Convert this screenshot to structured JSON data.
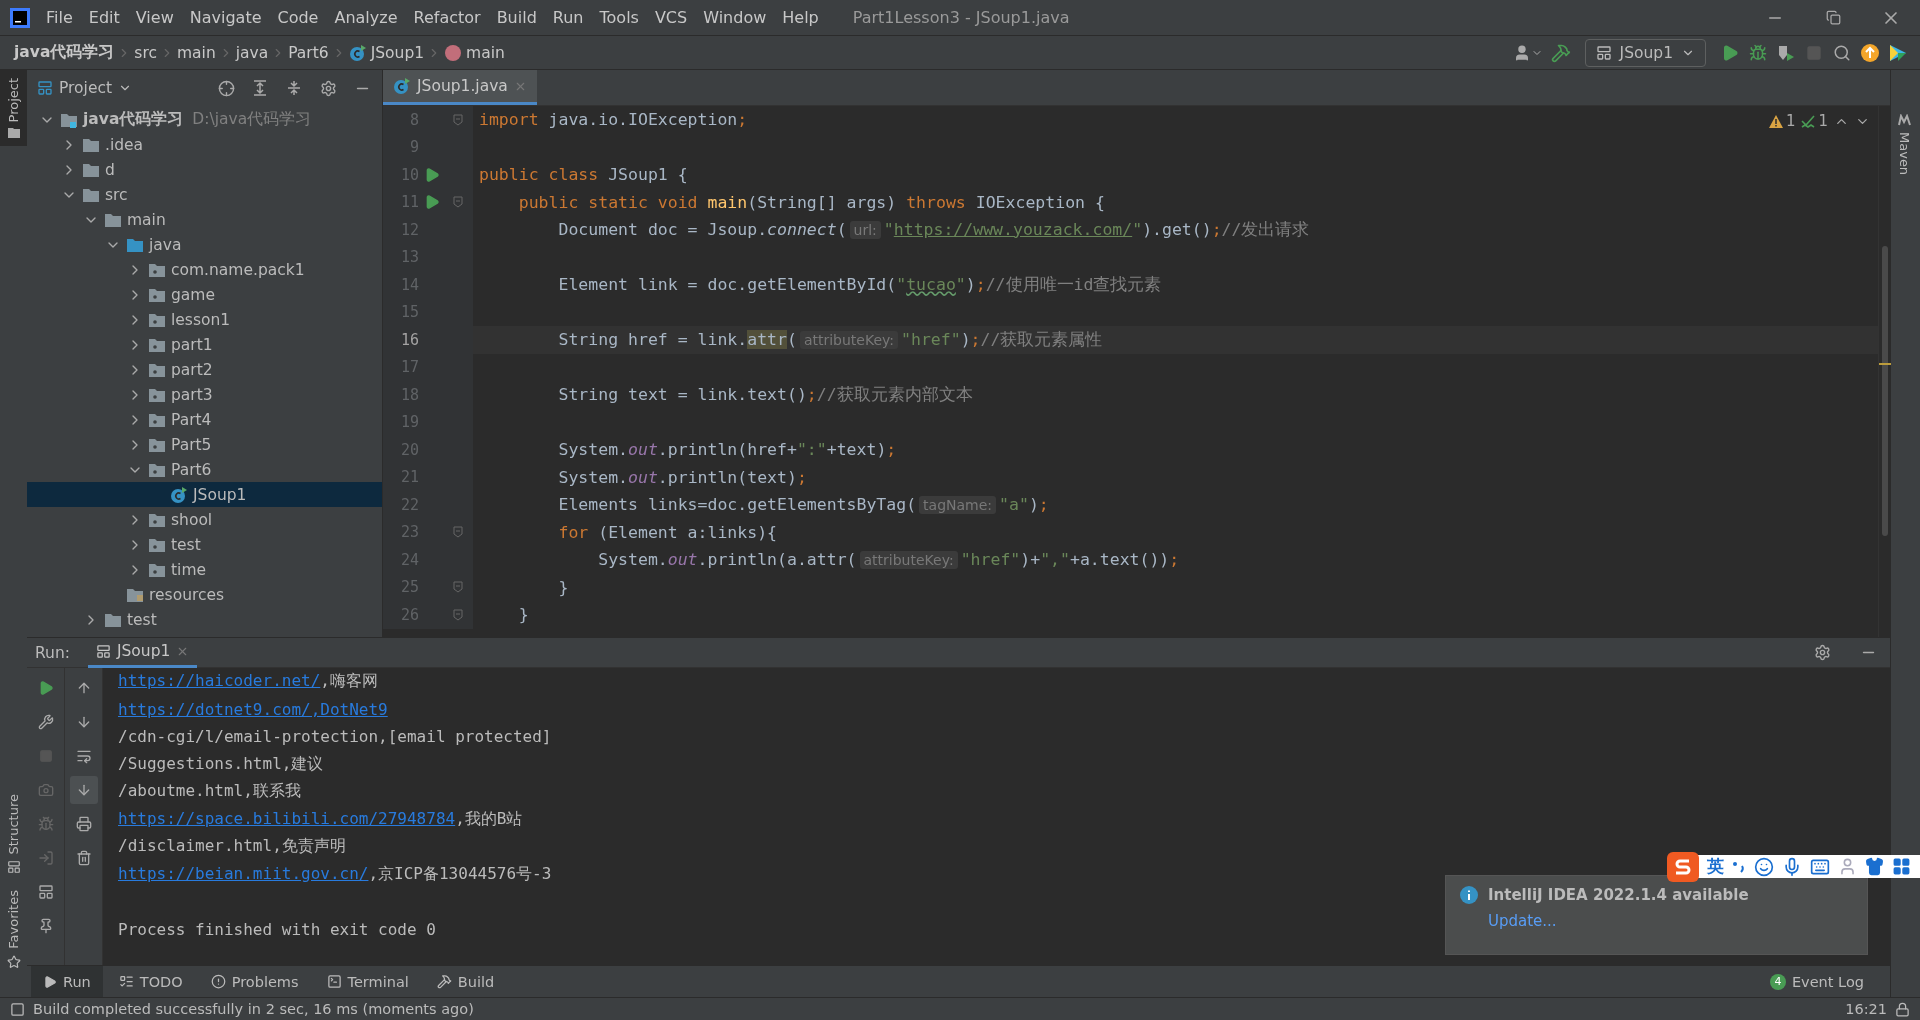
{
  "menu": [
    "File",
    "Edit",
    "View",
    "Navigate",
    "Code",
    "Analyze",
    "Refactor",
    "Build",
    "Run",
    "Tools",
    "VCS",
    "Window",
    "Help"
  ],
  "window": {
    "title": "Part1Lesson3 - JSoup1.java"
  },
  "breadcrumbs": [
    {
      "label": "java代码学习",
      "kind": "project"
    },
    {
      "label": "src",
      "kind": "folder"
    },
    {
      "label": "main",
      "kind": "folder"
    },
    {
      "label": "java",
      "kind": "folder"
    },
    {
      "label": "Part6",
      "kind": "folder"
    },
    {
      "label": "JSoup1",
      "kind": "class"
    },
    {
      "label": "main",
      "kind": "method"
    }
  ],
  "run_config": {
    "label": "JSoup1"
  },
  "side_tabs_left": [
    {
      "label": "Project",
      "selected": true
    },
    {
      "label": "Structure",
      "selected": false
    },
    {
      "label": "Favorites",
      "selected": false
    }
  ],
  "side_tabs_right": [
    {
      "label": "Maven",
      "selected": false
    }
  ],
  "project": {
    "title": "Project",
    "tree": [
      {
        "label": "java代码学习",
        "path": "D:\\java代码学习",
        "kind": "module",
        "expanded": true,
        "selected": false,
        "children": [
          {
            "label": ".idea",
            "kind": "folder",
            "expanded": false,
            "selected": false
          },
          {
            "label": "d",
            "kind": "folder",
            "expanded": false,
            "selected": false
          },
          {
            "label": "src",
            "kind": "folder",
            "expanded": true,
            "selected": false,
            "children": [
              {
                "label": "main",
                "kind": "folder",
                "expanded": true,
                "selected": false,
                "children": [
                  {
                    "label": "java",
                    "kind": "source",
                    "expanded": true,
                    "selected": false,
                    "children": [
                      {
                        "label": "com.name.pack1",
                        "kind": "package",
                        "expanded": false,
                        "selected": false
                      },
                      {
                        "label": "game",
                        "kind": "package",
                        "expanded": false,
                        "selected": false
                      },
                      {
                        "label": "lesson1",
                        "kind": "package",
                        "expanded": false,
                        "selected": false
                      },
                      {
                        "label": "part1",
                        "kind": "package",
                        "expanded": false,
                        "selected": false
                      },
                      {
                        "label": "part2",
                        "kind": "package",
                        "expanded": false,
                        "selected": false
                      },
                      {
                        "label": "part3",
                        "kind": "package",
                        "expanded": false,
                        "selected": false
                      },
                      {
                        "label": "Part4",
                        "kind": "package",
                        "expanded": false,
                        "selected": false
                      },
                      {
                        "label": "Part5",
                        "kind": "package",
                        "expanded": false,
                        "selected": false
                      },
                      {
                        "label": "Part6",
                        "kind": "package",
                        "expanded": true,
                        "selected": false,
                        "children": [
                          {
                            "label": "JSoup1",
                            "kind": "class",
                            "selected": true
                          }
                        ]
                      },
                      {
                        "label": "shool",
                        "kind": "package",
                        "expanded": false,
                        "selected": false
                      },
                      {
                        "label": "test",
                        "kind": "package",
                        "expanded": false,
                        "selected": false
                      },
                      {
                        "label": "time",
                        "kind": "package",
                        "expanded": false,
                        "selected": false
                      }
                    ]
                  },
                  {
                    "label": "resources",
                    "kind": "resources",
                    "selected": false
                  }
                ]
              },
              {
                "label": "test",
                "kind": "folder",
                "expanded": false,
                "selected": false
              }
            ]
          }
        ]
      }
    ]
  },
  "editor": {
    "tabs": [
      {
        "label": "JSoup1.java",
        "selected": true
      }
    ],
    "warnings": "1",
    "typos": "1",
    "lines": [
      {
        "number": "8",
        "fold": true,
        "run": false,
        "current": false,
        "tokens": [
          {
            "kind": "kw",
            "text": "import "
          },
          {
            "kind": "txt",
            "text": "java.io.IOException"
          },
          {
            "kind": "kw",
            "text": ";"
          }
        ]
      },
      {
        "number": "9",
        "fold": false,
        "run": false,
        "current": false
      },
      {
        "number": "10",
        "fold": false,
        "run": true,
        "current": false,
        "tokens": [
          {
            "kind": "kw",
            "text": "public class "
          },
          {
            "kind": "txt",
            "text": "JSoup1 {"
          }
        ]
      },
      {
        "number": "11",
        "fold": true,
        "run": true,
        "current": false,
        "tokens": [
          {
            "kind": "kw",
            "text": "    public static void "
          },
          {
            "kind": "fn",
            "text": "main"
          },
          {
            "kind": "txt",
            "text": "(String[] args) "
          },
          {
            "kind": "kw",
            "text": "throws "
          },
          {
            "kind": "txt",
            "text": "IOException {"
          }
        ]
      },
      {
        "number": "12",
        "fold": false,
        "run": false,
        "current": false,
        "tokens": [
          {
            "kind": "txt",
            "text": "        Document doc = Jsoup."
          },
          {
            "kind": "ital",
            "text": "connect"
          },
          {
            "kind": "txt",
            "text": "("
          },
          {
            "kind": "hint",
            "text": "url:"
          },
          {
            "kind": "str",
            "text": "\""
          },
          {
            "kind": "url",
            "text": "https://www.youzack.com/"
          },
          {
            "kind": "str",
            "text": "\""
          },
          {
            "kind": "txt",
            "text": ").get()"
          },
          {
            "kind": "kw",
            "text": ";"
          },
          {
            "kind": "cmt",
            "text": "//发出请求"
          }
        ]
      },
      {
        "number": "13",
        "fold": false,
        "run": false,
        "current": false
      },
      {
        "number": "14",
        "fold": false,
        "run": false,
        "current": false,
        "tokens": [
          {
            "kind": "txt",
            "text": "        Element link = doc.getElementById("
          },
          {
            "kind": "str",
            "text": "\""
          },
          {
            "kind": "typo",
            "text": "tucao"
          },
          {
            "kind": "str",
            "text": "\""
          },
          {
            "kind": "txt",
            "text": ")"
          },
          {
            "kind": "kw",
            "text": ";"
          },
          {
            "kind": "cmt",
            "text": "//使用唯一id查找元素"
          }
        ]
      },
      {
        "number": "15",
        "fold": false,
        "run": false,
        "current": false
      },
      {
        "number": "16",
        "fold": false,
        "run": false,
        "current": true,
        "tokens": [
          {
            "kind": "txt",
            "text": "        String href = link."
          },
          {
            "kind": "hl",
            "text": "attr"
          },
          {
            "kind": "txt",
            "text": "("
          },
          {
            "kind": "hint",
            "text": "attributeKey:"
          },
          {
            "kind": "str",
            "text": "\"href\""
          },
          {
            "kind": "txt",
            "text": ")"
          },
          {
            "kind": "kw",
            "text": ";"
          },
          {
            "kind": "cmt",
            "text": "//获取元素属性"
          }
        ]
      },
      {
        "number": "17",
        "fold": false,
        "run": false,
        "current": false
      },
      {
        "number": "18",
        "fold": false,
        "run": false,
        "current": false,
        "tokens": [
          {
            "kind": "txt",
            "text": "        String text = link.text()"
          },
          {
            "kind": "kw",
            "text": ";"
          },
          {
            "kind": "cmt",
            "text": "//获取元素内部文本"
          }
        ]
      },
      {
        "number": "19",
        "fold": false,
        "run": false,
        "current": false
      },
      {
        "number": "20",
        "fold": false,
        "run": false,
        "current": false,
        "tokens": [
          {
            "kind": "txt",
            "text": "        System."
          },
          {
            "kind": "field",
            "text": "out"
          },
          {
            "kind": "txt",
            "text": ".println(href+"
          },
          {
            "kind": "str",
            "text": "\":\""
          },
          {
            "kind": "txt",
            "text": "+text)"
          },
          {
            "kind": "kw",
            "text": ";"
          }
        ]
      },
      {
        "number": "21",
        "fold": false,
        "run": false,
        "current": false,
        "tokens": [
          {
            "kind": "txt",
            "text": "        System."
          },
          {
            "kind": "field",
            "text": "out"
          },
          {
            "kind": "txt",
            "text": ".println(text)"
          },
          {
            "kind": "kw",
            "text": ";"
          }
        ]
      },
      {
        "number": "22",
        "fold": false,
        "run": false,
        "current": false,
        "tokens": [
          {
            "kind": "txt",
            "text": "        Elements links=doc.getElementsByTag("
          },
          {
            "kind": "hint",
            "text": "tagName:"
          },
          {
            "kind": "str",
            "text": "\"a\""
          },
          {
            "kind": "txt",
            "text": ")"
          },
          {
            "kind": "kw",
            "text": ";"
          }
        ]
      },
      {
        "number": "23",
        "fold": true,
        "run": false,
        "current": false,
        "tokens": [
          {
            "kind": "kw",
            "text": "        for "
          },
          {
            "kind": "txt",
            "text": "(Element a:links){"
          }
        ]
      },
      {
        "number": "24",
        "fold": false,
        "run": false,
        "current": false,
        "tokens": [
          {
            "kind": "txt",
            "text": "            System."
          },
          {
            "kind": "field",
            "text": "out"
          },
          {
            "kind": "txt",
            "text": ".println(a.attr("
          },
          {
            "kind": "hint",
            "text": "attributeKey:"
          },
          {
            "kind": "str",
            "text": "\"href\""
          },
          {
            "kind": "txt",
            "text": ")+"
          },
          {
            "kind": "str",
            "text": "\",\""
          },
          {
            "kind": "txt",
            "text": "+a.text())"
          },
          {
            "kind": "kw",
            "text": ";"
          }
        ]
      },
      {
        "number": "25",
        "fold": true,
        "run": false,
        "current": false,
        "tokens": [
          {
            "kind": "txt",
            "text": "        }"
          }
        ]
      },
      {
        "number": "26",
        "fold": true,
        "run": false,
        "current": false,
        "tokens": [
          {
            "kind": "txt",
            "text": "    }"
          }
        ]
      }
    ]
  },
  "run_panel": {
    "label": "Run:",
    "tabs": [
      {
        "label": "JSoup1",
        "selected": true
      }
    ],
    "output": [
      {
        "blank_before": false,
        "segments": [
          {
            "text": "https://haicoder.net/",
            "link": true
          },
          {
            "text": ",嗨客网",
            "link": false
          }
        ]
      },
      {
        "blank_before": false,
        "segments": [
          {
            "text": "https://dotnet9.com/,DotNet9",
            "link": true
          }
        ]
      },
      {
        "blank_before": false,
        "segments": [
          {
            "text": "/cdn-cgi/l/email-protection,[email protected]",
            "link": false
          }
        ]
      },
      {
        "blank_before": false,
        "segments": [
          {
            "text": "/Suggestions.html,建议",
            "link": false
          }
        ]
      },
      {
        "blank_before": false,
        "segments": [
          {
            "text": "/aboutme.html,联系我",
            "link": false
          }
        ]
      },
      {
        "blank_before": false,
        "segments": [
          {
            "text": "https://space.bilibili.com/27948784",
            "link": true
          },
          {
            "text": ",我的B站",
            "link": false
          }
        ]
      },
      {
        "blank_before": false,
        "segments": [
          {
            "text": "/disclaimer.html,免责声明",
            "link": false
          }
        ]
      },
      {
        "blank_before": false,
        "segments": [
          {
            "text": "https://beian.miit.gov.cn/",
            "link": true
          },
          {
            "text": ",京ICP备13044576号-3",
            "link": false
          }
        ]
      },
      {
        "blank_before": true,
        "segments": [
          {
            "text": "Process finished with exit code 0",
            "link": false
          }
        ]
      }
    ]
  },
  "notification": {
    "title": "IntelliJ IDEA 2022.1.4 available",
    "action": "Update..."
  },
  "ime_bar": {
    "mode": "英"
  },
  "bottom_tabs": [
    {
      "label": "Run",
      "kind": "run",
      "selected": true
    },
    {
      "label": "TODO",
      "kind": "todo",
      "selected": false
    },
    {
      "label": "Problems",
      "kind": "problems",
      "selected": false
    },
    {
      "label": "Terminal",
      "kind": "terminal",
      "selected": false
    },
    {
      "label": "Build",
      "kind": "build",
      "selected": false
    }
  ],
  "event_log": {
    "label": "Event Log",
    "count": "4"
  },
  "status_bar": {
    "message": "Build completed successfully in 2 sec, 16 ms (moments ago)",
    "time": "16:21"
  }
}
